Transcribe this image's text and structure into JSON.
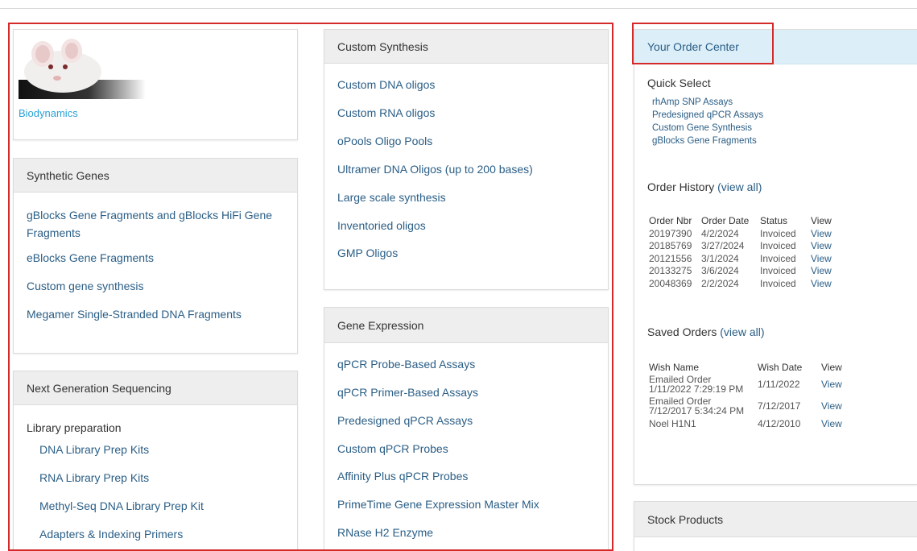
{
  "logo": {
    "caption": "Biodynamics"
  },
  "synthetic_genes": {
    "title": "Synthetic Genes",
    "items": [
      "gBlocks Gene Fragments and gBlocks HiFi Gene Fragments",
      "eBlocks Gene Fragments",
      "Custom gene synthesis",
      "Megamer Single-Stranded DNA Fragments"
    ]
  },
  "ngs": {
    "title": "Next Generation Sequencing",
    "subhead": "Library preparation",
    "items": [
      "DNA Library Prep Kits",
      "RNA Library Prep Kits",
      "Methyl-Seq DNA Library Prep Kit",
      "Adapters & Indexing Primers"
    ]
  },
  "custom_synthesis": {
    "title": "Custom Synthesis",
    "items": [
      "Custom DNA oligos",
      "Custom RNA oligos",
      "oPools Oligo Pools",
      "Ultramer DNA Oligos (up to 200 bases)",
      "Large scale synthesis",
      "Inventoried oligos",
      "GMP Oligos"
    ]
  },
  "gene_expression": {
    "title": "Gene Expression",
    "items": [
      "qPCR Probe-Based Assays",
      "qPCR Primer-Based Assays",
      "Predesigned qPCR Assays",
      "Custom qPCR Probes",
      "Affinity Plus qPCR Probes",
      "PrimeTime Gene Expression Master Mix",
      "RNase H2 Enzyme"
    ]
  },
  "order_center": {
    "title": "Your Order Center",
    "quick_select": {
      "label": "Quick Select",
      "items": [
        "rhAmp SNP Assays",
        "Predesigned qPCR Assays",
        "Custom Gene Synthesis",
        "gBlocks Gene Fragments"
      ]
    },
    "order_history": {
      "label": "Order History",
      "view_all": "(view all)",
      "headers": [
        "Order Nbr",
        "Order Date",
        "Status",
        "View"
      ],
      "rows": [
        [
          "20197390",
          "4/2/2024",
          "Invoiced",
          "View"
        ],
        [
          "20185769",
          "3/27/2024",
          "Invoiced",
          "View"
        ],
        [
          "20121556",
          "3/1/2024",
          "Invoiced",
          "View"
        ],
        [
          "20133275",
          "3/6/2024",
          "Invoiced",
          "View"
        ],
        [
          "20048369",
          "2/2/2024",
          "Invoiced",
          "View"
        ]
      ]
    },
    "saved_orders": {
      "label": "Saved Orders",
      "view_all": "(view all)",
      "headers": [
        "Wish Name",
        "Wish Date",
        "View"
      ],
      "rows": [
        [
          "Emailed Order 1/11/2022 7:29:19 PM",
          "1/11/2022",
          "View"
        ],
        [
          "Emailed Order 7/12/2017 5:34:24 PM",
          "7/12/2017",
          "View"
        ],
        [
          "Noel H1N1",
          "4/12/2010",
          "View"
        ]
      ]
    }
  },
  "stock_products": {
    "title": "Stock Products"
  },
  "colors": {
    "link": "#2a5e86",
    "highlight_border": "#d42a2a",
    "order_header_bg": "#dceef8",
    "logo_text": "#2aa1d6"
  }
}
